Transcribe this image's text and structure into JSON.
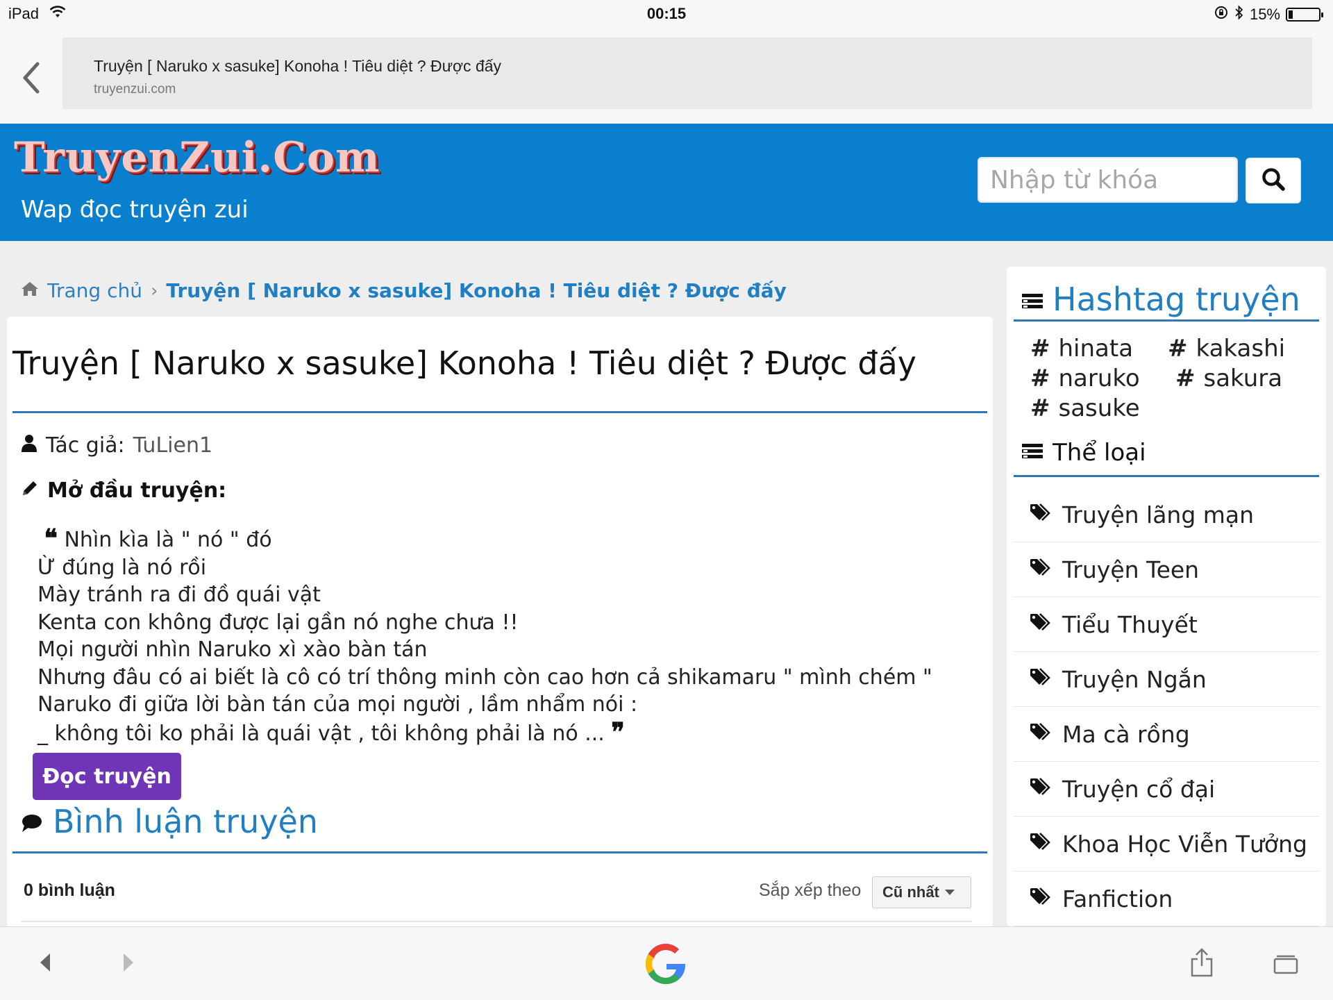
{
  "status_bar": {
    "device": "iPad",
    "time": "00:15",
    "battery": "15%",
    "battery_level": 0.15
  },
  "browser": {
    "page_title": "Truyện [ Naruko x sasuke] Konoha ! Tiêu diệt ? Được đấy",
    "domain": "truyenzui.com"
  },
  "site": {
    "logo": "TruyenZui.Com",
    "tagline": "Wap đọc truyện zui",
    "search_placeholder": "Nhập từ khóa"
  },
  "breadcrumb": {
    "home": "Trang chủ",
    "separator": "›",
    "current": "Truyện [ Naruko x sasuke] Konoha ! Tiêu diệt ? Được đấy"
  },
  "story": {
    "title": "Truyện [ Naruko x sasuke] Konoha ! Tiêu diệt ? Được đấy",
    "author_label": "Tác giả:",
    "author": "TuLien1",
    "intro_heading": "Mở đầu truyện:",
    "intro_lines": [
      "Nhìn kìa là \" nó \" đó",
      "Ừ đúng là nó rồi",
      "Mày tránh ra đi đồ quái vật",
      "Kenta con không được lại gần nó nghe chưa !!",
      "Mọi người nhìn Naruko xì xào bàn tán",
      "Nhưng đâu có ai biết là cô có trí thông minh còn cao hơn cả shikamaru \" mình chém \"",
      "Naruko đi giữa lời bàn tán của mọi người , lầm nhẩm nói :",
      "_ không tôi ko phải là quái vật , tôi không phải là nó ..."
    ],
    "read_button": "Đọc truyện"
  },
  "comments": {
    "heading": "Bình luận truyện",
    "count": "0 bình luận",
    "sort_label": "Sắp xếp theo",
    "sort_value": "Cũ nhất"
  },
  "sidebar": {
    "hashtag_heading": "Hashtag truyện",
    "hashtags": [
      "hinata",
      "kakashi",
      "naruko",
      "sakura",
      "sasuke"
    ],
    "genre_heading": "Thể loại",
    "genres": [
      "Truyện lãng mạn",
      "Truyện Teen",
      "Tiểu Thuyết",
      "Truyện Ngắn",
      "Ma cà rồng",
      "Truyện cổ đại",
      "Khoa Học Viễn Tưởng",
      "Fanfiction"
    ]
  },
  "icons": {
    "status": [
      "wifi-icon",
      "rotation-lock-icon",
      "bluetooth-icon",
      "battery-icon"
    ],
    "browser": [
      "back-chevron-icon"
    ],
    "toolbar": [
      "back-icon",
      "forward-icon",
      "google-logo",
      "share-icon",
      "tabs-icon"
    ],
    "content": [
      "home-icon",
      "user-icon",
      "pencil-icon",
      "quote-open-icon",
      "quote-close-icon",
      "comment-icon",
      "list-icon",
      "tag-icon"
    ]
  },
  "colors": {
    "header_blue": "#0a7fcd",
    "accent_blue": "#1f7fc2",
    "button_purple": "#6f35b6"
  }
}
